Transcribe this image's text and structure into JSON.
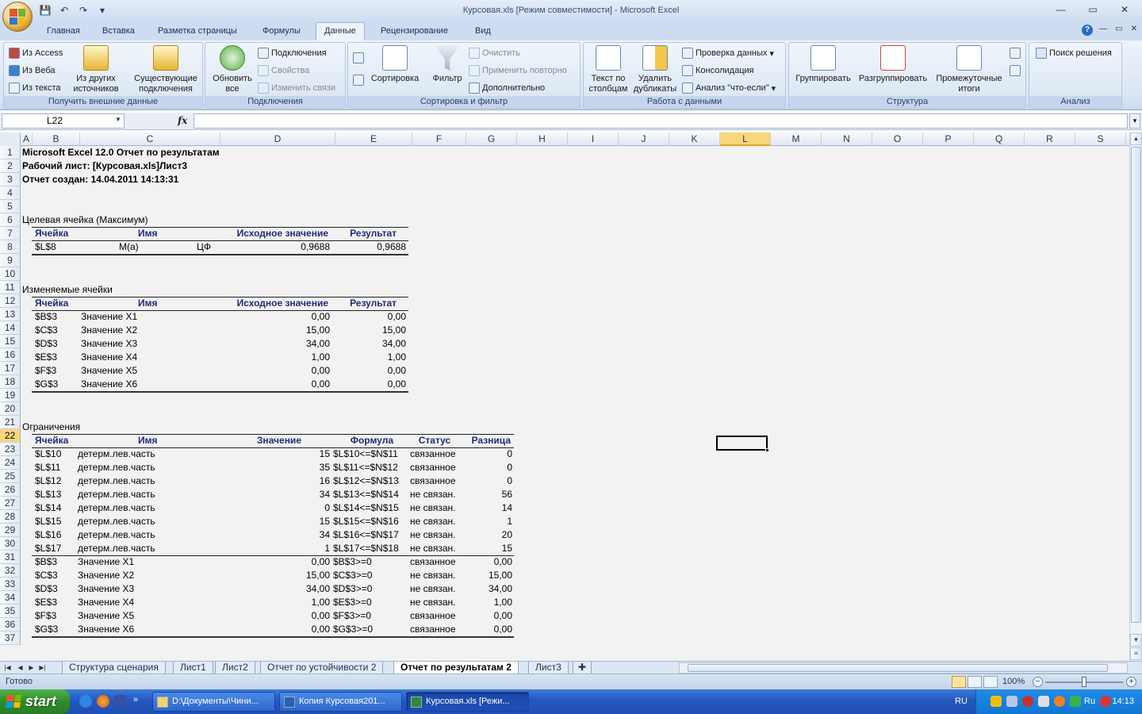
{
  "window": {
    "title": "Курсовая.xls  [Режим совместимости] - Microsoft Excel",
    "controls": [
      "—",
      "▭",
      "✕"
    ]
  },
  "ribbon_tabs": [
    "Главная",
    "Вставка",
    "Разметка страницы",
    "Формулы",
    "Данные",
    "Рецензирование",
    "Вид"
  ],
  "active_tab": "Данные",
  "ribbon": {
    "get_external": {
      "label": "Получить внешние данные",
      "from_access": "Из Access",
      "from_web": "Из Веба",
      "from_text": "Из текста",
      "other_sources": "Из других источников",
      "existing": "Существующие подключения"
    },
    "connections": {
      "label": "Подключения",
      "refresh_all": "Обновить все",
      "connections": "Подключения",
      "properties": "Свойства",
      "edit_links": "Изменить связи"
    },
    "sort_filter": {
      "label": "Сортировка и фильтр",
      "sort": "Сортировка",
      "filter": "Фильтр",
      "clear": "Очистить",
      "reapply": "Применить повторно",
      "advanced": "Дополнительно"
    },
    "data_tools": {
      "label": "Работа с данными",
      "text_to_columns": "Текст по столбцам",
      "remove_duplicates": "Удалить дубликаты",
      "validation": "Проверка данных",
      "consolidate": "Консолидация",
      "whatif": "Анализ \"что-если\""
    },
    "outline": {
      "label": "Структура",
      "group": "Группировать",
      "ungroup": "Разгруппировать",
      "subtotal": "Промежуточные итоги"
    },
    "analysis": {
      "label": "Анализ",
      "solver": "Поиск решения"
    }
  },
  "formula_bar": {
    "name_box": "L22",
    "fx": "fx",
    "formula": ""
  },
  "columns": [
    "A",
    "B",
    "C",
    "D",
    "E",
    "F",
    "G",
    "H",
    "I",
    "J",
    "K",
    "L",
    "M",
    "N",
    "O",
    "P",
    "Q",
    "R",
    "S"
  ],
  "selected_column": "L",
  "rows": [
    "1",
    "2",
    "3",
    "4",
    "5",
    "6",
    "7",
    "8",
    "9",
    "10",
    "11",
    "12",
    "13",
    "14",
    "15",
    "16",
    "17",
    "18",
    "19",
    "20",
    "21",
    "22",
    "23",
    "24",
    "25",
    "26",
    "27",
    "28",
    "29",
    "30",
    "31",
    "32",
    "33",
    "34",
    "35",
    "36",
    "37"
  ],
  "selected_row": "22",
  "report": {
    "line1": "Microsoft Excel 12.0 Отчет по результатам",
    "line2": "Рабочий лист: [Курсовая.xls]Лист3",
    "line3": "Отчет создан: 14.04.2011 14:13:31",
    "target_title": "Целевая ячейка (Максимум)",
    "target_headers": [
      "Ячейка",
      "Имя",
      "Исходное значение",
      "Результат"
    ],
    "target_row": {
      "cell": "$L$8",
      "name1": "M(a)",
      "name2": "ЦФ",
      "orig": "0,9688",
      "result": "0,9688"
    },
    "changing_title": "Изменяемые ячейки",
    "changing_headers": [
      "Ячейка",
      "Имя",
      "Исходное значение",
      "Результат"
    ],
    "changing_rows": [
      {
        "cell": "$B$3",
        "name": "Значение X1",
        "orig": "0,00",
        "result": "0,00"
      },
      {
        "cell": "$C$3",
        "name": "Значение X2",
        "orig": "15,00",
        "result": "15,00"
      },
      {
        "cell": "$D$3",
        "name": "Значение X3",
        "orig": "34,00",
        "result": "34,00"
      },
      {
        "cell": "$E$3",
        "name": "Значение X4",
        "orig": "1,00",
        "result": "1,00"
      },
      {
        "cell": "$F$3",
        "name": "Значение X5",
        "orig": "0,00",
        "result": "0,00"
      },
      {
        "cell": "$G$3",
        "name": "Значение X6",
        "orig": "0,00",
        "result": "0,00"
      }
    ],
    "constraints_title": "Ограничения",
    "constraints_headers": [
      "Ячейка",
      "Имя",
      "Значение",
      "Формула",
      "Статус",
      "Разница"
    ],
    "constraints_rows": [
      {
        "cell": "$L$10",
        "name": "детерм.лев.часть",
        "value": "15",
        "formula": "$L$10<=$N$11",
        "status": "связанное",
        "diff": "0"
      },
      {
        "cell": "$L$11",
        "name": "детерм.лев.часть",
        "value": "35",
        "formula": "$L$11<=$N$12",
        "status": "связанное",
        "diff": "0"
      },
      {
        "cell": "$L$12",
        "name": "детерм.лев.часть",
        "value": "16",
        "formula": "$L$12<=$N$13",
        "status": "связанное",
        "diff": "0"
      },
      {
        "cell": "$L$13",
        "name": "детерм.лев.часть",
        "value": "34",
        "formula": "$L$13<=$N$14",
        "status": "не связан.",
        "diff": "56"
      },
      {
        "cell": "$L$14",
        "name": "детерм.лев.часть",
        "value": "0",
        "formula": "$L$14<=$N$15",
        "status": "не связан.",
        "diff": "14"
      },
      {
        "cell": "$L$15",
        "name": "детерм.лев.часть",
        "value": "15",
        "formula": "$L$15<=$N$16",
        "status": "не связан.",
        "diff": "1"
      },
      {
        "cell": "$L$16",
        "name": "детерм.лев.часть",
        "value": "34",
        "formula": "$L$16<=$N$17",
        "status": "не связан.",
        "diff": "20"
      },
      {
        "cell": "$L$17",
        "name": "детерм.лев.часть",
        "value": "1",
        "formula": "$L$17<=$N$18",
        "status": "не связан.",
        "diff": "15"
      },
      {
        "cell": "$B$3",
        "name": "Значение X1",
        "value": "0,00",
        "formula": "$B$3>=0",
        "status": "связанное",
        "diff": "0,00"
      },
      {
        "cell": "$C$3",
        "name": "Значение X2",
        "value": "15,00",
        "formula": "$C$3>=0",
        "status": "не связан.",
        "diff": "15,00"
      },
      {
        "cell": "$D$3",
        "name": "Значение X3",
        "value": "34,00",
        "formula": "$D$3>=0",
        "status": "не связан.",
        "diff": "34,00"
      },
      {
        "cell": "$E$3",
        "name": "Значение X4",
        "value": "1,00",
        "formula": "$E$3>=0",
        "status": "не связан.",
        "diff": "1,00"
      },
      {
        "cell": "$F$3",
        "name": "Значение X5",
        "value": "0,00",
        "formula": "$F$3>=0",
        "status": "связанное",
        "diff": "0,00"
      },
      {
        "cell": "$G$3",
        "name": "Значение X6",
        "value": "0,00",
        "formula": "$G$3>=0",
        "status": "связанное",
        "diff": "0,00"
      }
    ]
  },
  "sheet_tabs": [
    "Структура сценария",
    "Лист1",
    "Лист2",
    "Отчет по устойчивости 2",
    "Отчет по результатам 2",
    "Лист3"
  ],
  "active_sheet": "Отчет по результатам 2",
  "status": {
    "ready": "Готово",
    "zoom": "100%",
    "zoom_minus": "−",
    "zoom_plus": "+"
  },
  "taskbar": {
    "start": "start",
    "tasks": [
      "D:\\Документы\\Чини...",
      "Копия Курсовая201...",
      "Курсовая.xls  [Режи..."
    ],
    "active_task": 2,
    "lang": "RU",
    "tray_lang": "Ru",
    "clock": "14:13"
  },
  "colors": {
    "header_text": "#1f2a77",
    "selection": "#f8d77c",
    "ribbon_bg": "#d8e4f3",
    "taskbar": "#2458c0"
  }
}
